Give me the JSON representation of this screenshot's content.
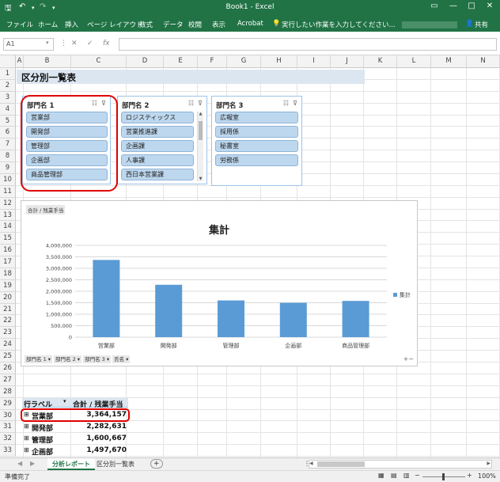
{
  "title_bar": {
    "title": "Book1 - Excel",
    "save_icon": "save-icon",
    "undo_icon": "undo-icon",
    "redo_icon": "redo-icon"
  },
  "ribbon": {
    "tabs": [
      "ファイル",
      "ホーム",
      "挿入",
      "ページ レイアウト",
      "数式",
      "データ",
      "校閲",
      "表示",
      "Acrobat"
    ],
    "tell_me": "実行したい作業を入力してください...",
    "share": "共有"
  },
  "formula_bar": {
    "name_box": "A1",
    "cancel": "✕",
    "enter": "✓",
    "fx": "fx",
    "value": ""
  },
  "columns": [
    "A",
    "B",
    "C",
    "D",
    "E",
    "F",
    "G",
    "H",
    "I",
    "J",
    "K",
    "L",
    "M",
    "N"
  ],
  "rows": [
    "1",
    "2",
    "3",
    "4",
    "5",
    "6",
    "7",
    "8",
    "9",
    "10",
    "11",
    "12",
    "13",
    "14",
    "15",
    "16",
    "17",
    "18",
    "19",
    "20",
    "21",
    "22",
    "23",
    "24",
    "25",
    "26",
    "27",
    "28",
    "29",
    "30",
    "31",
    "32",
    "33"
  ],
  "sheet_title": "区分別一覧表",
  "slicers": [
    {
      "title": "部門名 1",
      "items": [
        "営業部",
        "開発部",
        "管理部",
        "企画部",
        "商品管理部"
      ]
    },
    {
      "title": "部門名 2",
      "items": [
        "ロジスティックス",
        "営業推進課",
        "企画課",
        "人事課",
        "西日本営業課"
      ]
    },
    {
      "title": "部門名 3",
      "items": [
        "広報室",
        "採用係",
        "秘書室",
        "労務係"
      ]
    }
  ],
  "chart": {
    "field_button": "合計 / 残業手当",
    "bottom_buttons": [
      "部門名 1 ▾",
      "部門名 2 ▾",
      "部門名 3 ▾",
      "氏名 ▾"
    ],
    "plus_minus": "+−"
  },
  "chart_data": {
    "type": "bar",
    "title": "集計",
    "categories": [
      "営業部",
      "開発部",
      "管理部",
      "企画部",
      "商品管理部"
    ],
    "series": [
      {
        "name": "集計",
        "values": [
          3364157,
          2282631,
          1600667,
          1497670,
          1580000
        ]
      }
    ],
    "ylim": [
      0,
      4000000
    ],
    "yticks": [
      "0",
      "500,000",
      "1,000,000",
      "1,500,000",
      "2,000,000",
      "2,500,000",
      "3,000,000",
      "3,500,000",
      "4,000,000"
    ],
    "color": "#5b9bd5",
    "grid": true,
    "legend": "right"
  },
  "pivot": {
    "header_label": "行ラベル",
    "header_sum": "合計 / 残業手当",
    "rows": [
      {
        "label": "営業部",
        "value": "3,364,157"
      },
      {
        "label": "開発部",
        "value": "2,282,631"
      },
      {
        "label": "管理部",
        "value": "1,600,667"
      },
      {
        "label": "企画部",
        "value": "1,497,670"
      }
    ]
  },
  "sheet_tabs": {
    "active": "分析レポート",
    "other": "区分別一覧表",
    "add": "+"
  },
  "status_bar": {
    "status": "準備完了",
    "zoom": "100%"
  }
}
